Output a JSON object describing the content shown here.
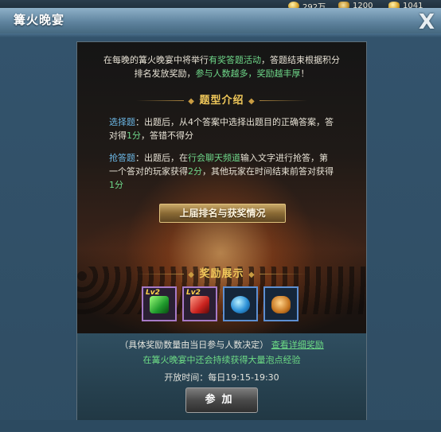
{
  "resources": [
    {
      "icon": "coin-icon",
      "value": "292万"
    },
    {
      "icon": "money-bag-icon",
      "value": "1200"
    },
    {
      "icon": "gold-ingot-icon",
      "value": "1041"
    }
  ],
  "window": {
    "title": "篝火晚宴",
    "close_label": "X"
  },
  "intro": {
    "line1_a": "在每晚的篝火晚宴中将举行",
    "line1_b": "有奖答题活动",
    "line1_c": "，答题结束根据积分",
    "line2_a": "排名发放奖励，",
    "line2_b": "参与人数越多，奖励越丰厚",
    "line2_c": "！"
  },
  "section_intro": "题型介绍",
  "choice": {
    "label": "选择题",
    "text_a": "：出题后，从4个答案中选择出题目的正确答案，答对得",
    "score": "1分",
    "text_b": "，答错不得分"
  },
  "race": {
    "label": "抢答题",
    "text_a": "：出题后，在",
    "channel": "行会聊天频道",
    "text_b": "输入文字进行抢答，第一个答对的玩家获得",
    "score_first": "2分",
    "text_c": "，其他玩家在时间结束前答对获得",
    "score_other": "1分"
  },
  "history_button": "上届排名与获奖情况",
  "section_rewards": "奖励展示",
  "rewards": [
    {
      "icon": "green-gem-icon",
      "badge": "Lv2"
    },
    {
      "icon": "red-gem-icon",
      "badge": "Lv2"
    },
    {
      "icon": "blue-orb-icon",
      "badge": ""
    },
    {
      "icon": "gold-ore-icon",
      "badge": ""
    }
  ],
  "note": {
    "text": "（具体奖励数量由当日参与人数决定）",
    "link": "查看详细奖励",
    "exp_text": "在篝火晚宴中还会持续获得大量泡点经验",
    "time": "开放时间：每日19:15-19:30"
  },
  "join_button": "参加"
}
